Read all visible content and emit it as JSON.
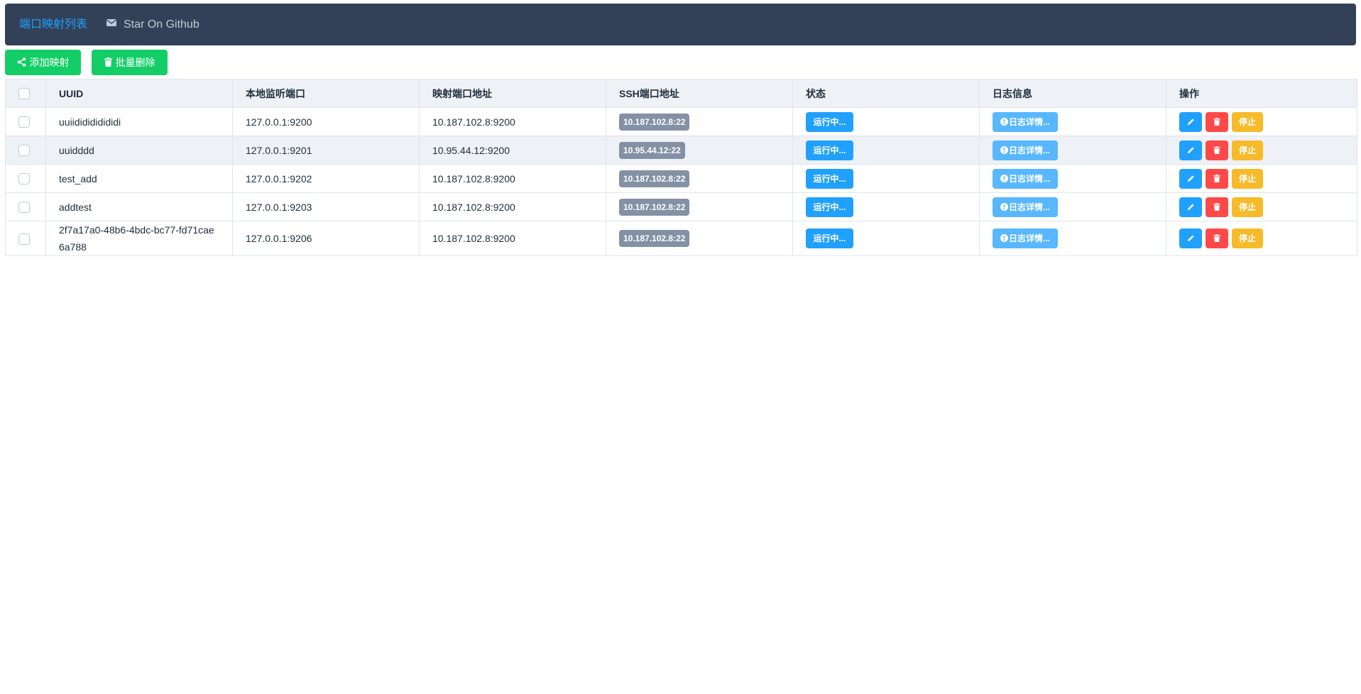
{
  "nav": {
    "active_tab": "端口映射列表",
    "github_link": "Star On Github"
  },
  "toolbar": {
    "add_label": "添加映射",
    "batch_delete_label": "批量删除"
  },
  "table": {
    "columns": {
      "uuid": "UUID",
      "local_port": "本地监听端口",
      "mapped_addr": "映射端口地址",
      "ssh_addr": "SSH端口地址",
      "status": "状态",
      "log": "日志信息",
      "actions": "操作"
    },
    "rows": [
      {
        "uuid": "uuiididididididi",
        "local_port": "127.0.0.1:9200",
        "mapped_addr": "10.187.102.8:9200",
        "ssh_addr": "10.187.102.8:22",
        "status": "运行中...",
        "log": "日志详情...",
        "stop": "停止"
      },
      {
        "uuid": "uuidddd",
        "local_port": "127.0.0.1:9201",
        "mapped_addr": "10.95.44.12:9200",
        "ssh_addr": "10.95.44.12:22",
        "status": "运行中...",
        "log": "日志详情...",
        "stop": "停止"
      },
      {
        "uuid": "test_add",
        "local_port": "127.0.0.1:9202",
        "mapped_addr": "10.187.102.8:9200",
        "ssh_addr": "10.187.102.8:22",
        "status": "运行中...",
        "log": "日志详情...",
        "stop": "停止"
      },
      {
        "uuid": "addtest",
        "local_port": "127.0.0.1:9203",
        "mapped_addr": "10.187.102.8:9200",
        "ssh_addr": "10.187.102.8:22",
        "status": "运行中...",
        "log": "日志详情...",
        "stop": "停止"
      },
      {
        "uuid": "2f7a17a0-48b6-4bdc-bc77-fd71cae6a788",
        "local_port": "127.0.0.1:9206",
        "mapped_addr": "10.187.102.8:9200",
        "ssh_addr": "10.187.102.8:22",
        "status": "运行中...",
        "log": "日志详情...",
        "stop": "停止"
      }
    ]
  },
  "icons": {
    "nav_github": "mail-icon",
    "add": "share-icon",
    "batch_delete": "trash-icon",
    "log": "info-circle-icon",
    "edit": "pencil-icon",
    "delete": "trash-icon"
  },
  "colors": {
    "navbar_bg": "#324157",
    "active_tab": "#20a0ff",
    "success": "#13ce66",
    "primary": "#20a0ff",
    "info_light": "#58b7ff",
    "danger": "#ff4949",
    "warning": "#f7ba2a",
    "tag_gray": "#8391a5"
  }
}
